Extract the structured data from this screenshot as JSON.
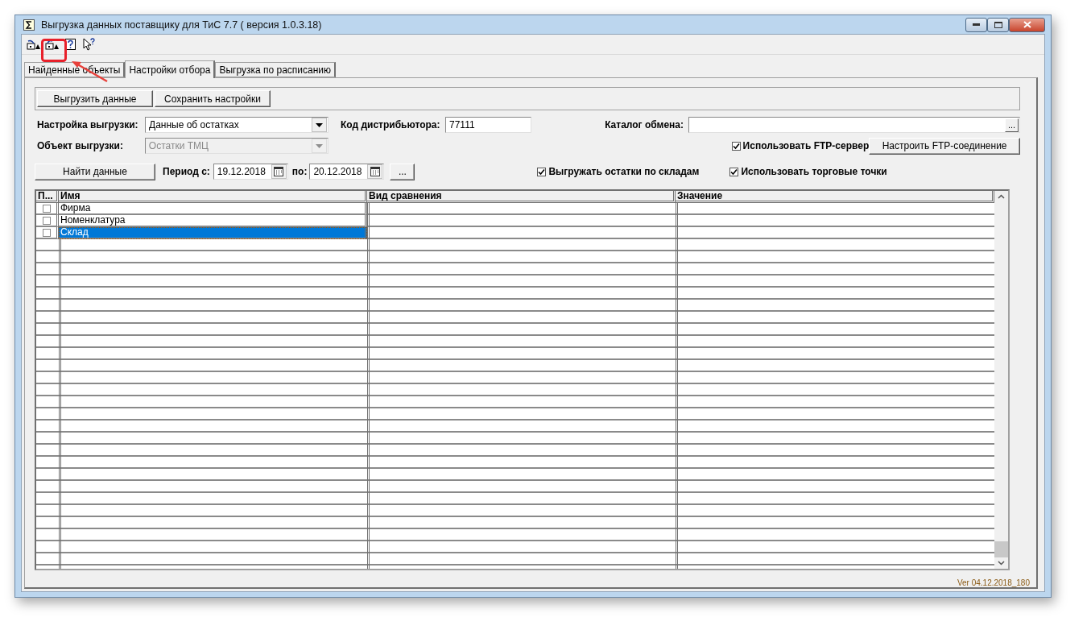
{
  "window": {
    "title": "Выгрузка данных поставщику для ТиС 7.7 ( версия 1.0.3.18)"
  },
  "tabs": [
    {
      "label": "Найденные объекты",
      "selected": false
    },
    {
      "label": "Настройки отбора",
      "selected": true
    },
    {
      "label": "Выгрузка по расписанию",
      "selected": false
    }
  ],
  "action_buttons": [
    "Выгрузить данные",
    "Сохранить настройки"
  ],
  "export_setting": {
    "label": "Настройка выгрузки:",
    "value": "Данные об остатках"
  },
  "distributor_code": {
    "label": "Код дистрибьютора:",
    "value": "77111"
  },
  "exchange_folder": {
    "label": "Каталог обмена:",
    "browse": "..."
  },
  "export_object": {
    "label": "Объект выгрузки:",
    "value": "Остатки ТМЦ",
    "disabled": true
  },
  "ftp_server": {
    "label": "Использовать FTP-сервер",
    "checked": true
  },
  "ftp_button": "Настроить FTP-соединение",
  "find_button": "Найти данные",
  "period": {
    "from_label": "Период с:",
    "from": "19.12.2018",
    "to_label": "по:",
    "to": "20.12.2018",
    "more": "..."
  },
  "by_warehouse": {
    "label": "Выгружать остатки по складам",
    "checked": true
  },
  "trade_points": {
    "label": "Использовать торговые точки",
    "checked": true
  },
  "table": {
    "columns": [
      "П...",
      "Имя",
      "Вид сравнения",
      "Значение"
    ],
    "rows": [
      {
        "name": "Фирма",
        "checked": false,
        "selected": false
      },
      {
        "name": "Номенклатура",
        "checked": false,
        "selected": false
      },
      {
        "name": "Склад",
        "checked": false,
        "selected": true
      }
    ]
  },
  "version": "Ver 04.12.2018_180"
}
